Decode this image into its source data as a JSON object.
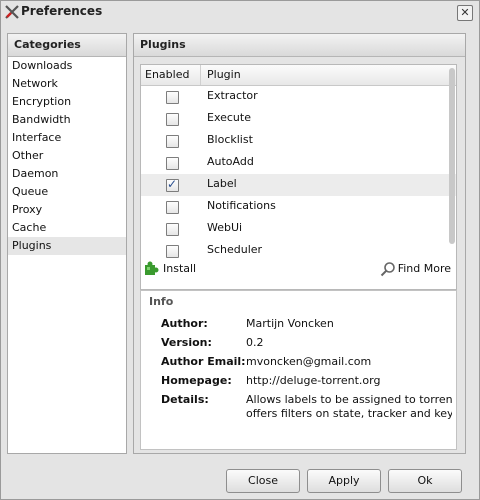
{
  "window": {
    "title": "Preferences",
    "close_glyph": "✕"
  },
  "categories": {
    "header": "Categories",
    "items": [
      "Downloads",
      "Network",
      "Encryption",
      "Bandwidth",
      "Interface",
      "Other",
      "Daemon",
      "Queue",
      "Proxy",
      "Cache",
      "Plugins"
    ],
    "selected": "Plugins"
  },
  "plugins": {
    "header": "Plugins",
    "columns": {
      "enabled": "Enabled",
      "plugin": "Plugin"
    },
    "rows": [
      {
        "name": "Extractor",
        "enabled": false
      },
      {
        "name": "Execute",
        "enabled": false
      },
      {
        "name": "Blocklist",
        "enabled": false
      },
      {
        "name": "AutoAdd",
        "enabled": false
      },
      {
        "name": "Label",
        "enabled": true
      },
      {
        "name": "Notifications",
        "enabled": false
      },
      {
        "name": "WebUi",
        "enabled": false
      },
      {
        "name": "Scheduler",
        "enabled": false
      }
    ],
    "selected": "Label",
    "toolbar": {
      "install": "Install",
      "find_more": "Find More"
    }
  },
  "info": {
    "legend": "Info",
    "author_label": "Author:",
    "author": "Martijn Voncken",
    "version_label": "Version:",
    "version": "0.2",
    "email_label": "Author Email:",
    "email": "mvoncken@gmail.com",
    "homepage_label": "Homepage:",
    "homepage": "http://deluge-torrent.org",
    "details_label": "Details:",
    "details_line1": "Allows labels to be assigned to torrents Als",
    "details_line2": "offers filters on state, tracker and keyword"
  },
  "buttons": {
    "close": "Close",
    "apply": "Apply",
    "ok": "Ok"
  },
  "icons": {
    "title": "deluge-icon",
    "install": "puzzle-icon",
    "find_more": "magnifier-icon"
  }
}
